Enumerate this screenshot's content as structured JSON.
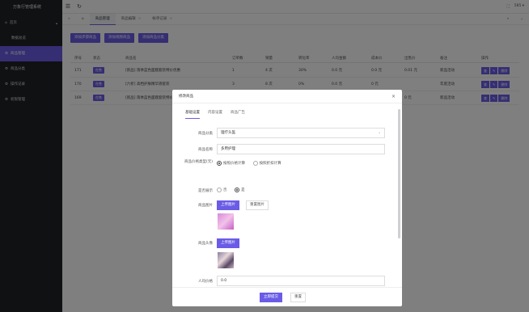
{
  "app": {
    "title": "万象行管理系统"
  },
  "sidebar": {
    "items": [
      {
        "label": "首页",
        "caret": "▴"
      },
      {
        "label": "数据总览"
      },
      {
        "label": "商品管理"
      },
      {
        "label": "商品分类"
      },
      {
        "label": "操作记录"
      },
      {
        "label": "权限管理"
      }
    ]
  },
  "topbar": {
    "menu_icon": "☰",
    "refresh_icon": "↻",
    "fullscreen_icon": "⛶",
    "user": "585 ▾"
  },
  "tabs": {
    "items": [
      {
        "label": "商品管理",
        "close": ""
      },
      {
        "label": "商品编辑",
        "close": "×"
      },
      {
        "label": "帐单记录",
        "close": "×"
      }
    ],
    "left": "«",
    "home": "⌂",
    "right": "»",
    "down": "⌄"
  },
  "toolbar": {
    "buttons": [
      "添加步骤商品",
      "添加视频商品",
      "添加商品分类"
    ]
  },
  "table": {
    "headers": [
      "序号",
      "状态",
      "商品名",
      "订单数",
      "销量",
      "转化率",
      "人均金额",
      "成本价",
      "出售价",
      "备注",
      "操作"
    ],
    "rows": [
      {
        "id": "171",
        "status": "在售",
        "name": "[新品] 雨季蓝色面膜套装特价优惠",
        "orders": "1",
        "sales": "4 次",
        "rate": "30%",
        "avg": "0.0 元",
        "cost": "0.0 元",
        "price": "0.01 元",
        "note": "新品活动"
      },
      {
        "id": "170",
        "status": "在售",
        "name": "[六折] 高档护肤精华液套装",
        "orders": "3",
        "sales": "8 次",
        "rate": "0%",
        "avg": "0.0 元",
        "cost": "0 元",
        "price": "",
        "note": "年底活动"
      },
      {
        "id": "169",
        "status": "在售",
        "name": "[新品] 雨季蓝色面膜套装特价优惠",
        "orders": "",
        "sales": "",
        "rate": "",
        "avg": "",
        "cost": "",
        "price": "0 元",
        "note": "新品活动"
      }
    ],
    "ops": [
      "查",
      "✎",
      "删除"
    ]
  },
  "modal": {
    "title": "修改商品",
    "close": "×",
    "tabs": [
      "基础设置",
      "内容设置",
      "商品广告"
    ],
    "fields": {
      "category_label": "商品分类",
      "category_value": "理疗头盔",
      "name_label": "商品名称",
      "name_value": "多用护理",
      "sale_label": "商品价格类型(元)",
      "sale_options": [
        "按照价格计算",
        "按照折扣计算"
      ],
      "show_label": "是否展示",
      "show_options": [
        "否",
        "是"
      ],
      "image_label": "商品图片",
      "upload": "上传图片",
      "preview": "重置图片",
      "avatar_label": "商品头像",
      "price_label": "人均价格",
      "price_value": "0.0"
    },
    "submit": "立即提交",
    "reset": "重置"
  }
}
